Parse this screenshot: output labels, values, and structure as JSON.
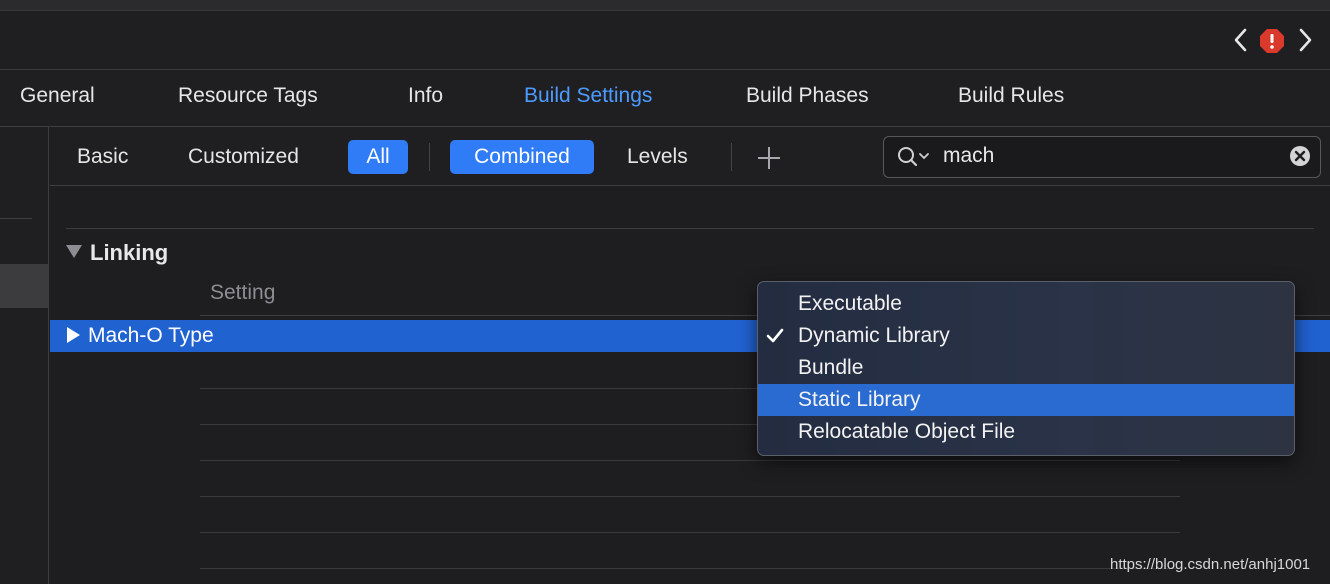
{
  "tabs": [
    {
      "label": "General"
    },
    {
      "label": "Resource Tags"
    },
    {
      "label": "Info"
    },
    {
      "label": "Build Settings",
      "active": true
    },
    {
      "label": "Build Phases"
    },
    {
      "label": "Build Rules"
    }
  ],
  "filter": {
    "basic": "Basic",
    "customized": "Customized",
    "all": "All",
    "combined": "Combined",
    "levels": "Levels"
  },
  "search": {
    "value": "mach",
    "placeholder": ""
  },
  "section": {
    "title": "Linking",
    "column_header": "Setting",
    "selected_row": "Mach-O Type"
  },
  "popup": {
    "items": [
      {
        "label": "Executable",
        "checked": false,
        "highlighted": false
      },
      {
        "label": "Dynamic Library",
        "checked": true,
        "highlighted": false
      },
      {
        "label": "Bundle",
        "checked": false,
        "highlighted": false
      },
      {
        "label": "Static Library",
        "checked": false,
        "highlighted": true
      },
      {
        "label": "Relocatable Object File",
        "checked": false,
        "highlighted": false
      }
    ]
  },
  "watermark": "https://blog.csdn.net/anhj1001",
  "colors": {
    "accent": "#2f7cf6",
    "active_tab": "#4e9bff",
    "selection": "#2162d1",
    "issue_badge": "#d93a2b"
  },
  "icons": [
    "chevron-left-icon",
    "issue-badge-icon",
    "chevron-right-icon",
    "plus-icon",
    "search-icon",
    "clear-icon",
    "disclosure-triangle-icon",
    "checkmark-icon"
  ]
}
